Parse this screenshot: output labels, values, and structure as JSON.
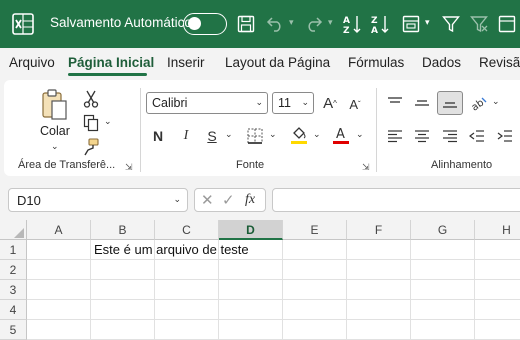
{
  "titlebar": {
    "autosave_label": "Salvamento Automático",
    "autosave_toggle": "off"
  },
  "tabs": [
    "Arquivo",
    "Página Inicial",
    "Inserir",
    "Layout da Página",
    "Fórmulas",
    "Dados",
    "Revisão"
  ],
  "active_tab": "Página Inicial",
  "ribbon": {
    "clipboard": {
      "paste_label": "Colar",
      "group_label": "Área de Transferê..."
    },
    "font": {
      "font_name": "Calibri",
      "font_size": "11",
      "bold": "N",
      "italic": "I",
      "underline": "S",
      "group_label": "Fonte",
      "highlight_color": "#ffd900",
      "font_color": "#e00000"
    },
    "alignment": {
      "group_label": "Alinhamento"
    }
  },
  "formula_bar": {
    "name_box": "D10",
    "fx_label": "fx",
    "formula_value": ""
  },
  "sheet": {
    "columns": [
      "A",
      "B",
      "C",
      "D",
      "E",
      "F",
      "G",
      "H"
    ],
    "selected_column": "D",
    "rows": [
      "1",
      "2",
      "3",
      "4",
      "5"
    ],
    "cells": {
      "B1": "Este é um arquivo de teste"
    }
  },
  "colors": {
    "accent": "#217346",
    "ribbon_bg": "#f3f3f3"
  }
}
